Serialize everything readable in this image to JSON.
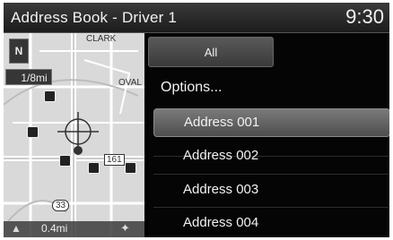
{
  "header": {
    "title": "Address Book - Driver 1",
    "clock": "9:30"
  },
  "map": {
    "north_label": "N",
    "scale_top": "1/8mi",
    "scale_bottom": "0.4mi",
    "road_labels": [
      "CLARK",
      "OVAL",
      "161",
      "33"
    ]
  },
  "panel": {
    "tab_all": "All",
    "options_label": "Options...",
    "addresses": [
      "Address 001",
      "Address 002",
      "Address 003",
      "Address 004"
    ],
    "selected_index": 0
  },
  "colors": {
    "selected_bg": "#6a6a6a",
    "panel_bg": "#050505",
    "map_bg": "#d9d9d9"
  }
}
